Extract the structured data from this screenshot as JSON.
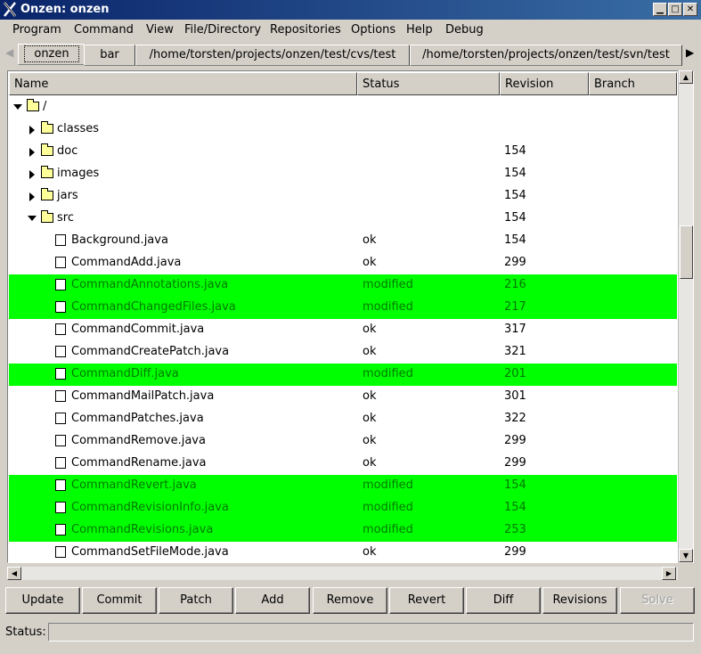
{
  "window": {
    "title": "Onzen: onzen"
  },
  "menu": [
    "Program",
    "Command",
    "View",
    "File/Directory",
    "Repositories",
    "Options",
    "Help",
    "Debug"
  ],
  "tabs": [
    "onzen",
    "bar",
    "/home/torsten/projects/onzen/test/cvs/test",
    "/home/torsten/projects/onzen/test/svn/test"
  ],
  "columns": [
    "Name",
    "Status",
    "Revision",
    "Branch"
  ],
  "tree": [
    {
      "name": "/",
      "type": "folder",
      "expand": "down",
      "level": 0,
      "status": "",
      "revision": "",
      "modified": false
    },
    {
      "name": "classes",
      "type": "folder",
      "expand": "right",
      "level": 1,
      "status": "",
      "revision": "",
      "modified": false
    },
    {
      "name": "doc",
      "type": "folder",
      "expand": "right",
      "level": 1,
      "status": "",
      "revision": "154",
      "modified": false
    },
    {
      "name": "images",
      "type": "folder",
      "expand": "right",
      "level": 1,
      "status": "",
      "revision": "154",
      "modified": false
    },
    {
      "name": "jars",
      "type": "folder",
      "expand": "right",
      "level": 1,
      "status": "",
      "revision": "154",
      "modified": false
    },
    {
      "name": "src",
      "type": "folder",
      "expand": "down",
      "level": 1,
      "status": "",
      "revision": "154",
      "modified": false
    },
    {
      "name": "Background.java",
      "type": "file",
      "level": 2,
      "status": "ok",
      "revision": "154",
      "modified": false
    },
    {
      "name": "CommandAdd.java",
      "type": "file",
      "level": 2,
      "status": "ok",
      "revision": "299",
      "modified": false
    },
    {
      "name": "CommandAnnotations.java",
      "type": "file",
      "level": 2,
      "status": "modified",
      "revision": "216",
      "modified": true
    },
    {
      "name": "CommandChangedFiles.java",
      "type": "file",
      "level": 2,
      "status": "modified",
      "revision": "217",
      "modified": true
    },
    {
      "name": "CommandCommit.java",
      "type": "file",
      "level": 2,
      "status": "ok",
      "revision": "317",
      "modified": false
    },
    {
      "name": "CommandCreatePatch.java",
      "type": "file",
      "level": 2,
      "status": "ok",
      "revision": "321",
      "modified": false
    },
    {
      "name": "CommandDiff.java",
      "type": "file",
      "level": 2,
      "status": "modified",
      "revision": "201",
      "modified": true
    },
    {
      "name": "CommandMailPatch.java",
      "type": "file",
      "level": 2,
      "status": "ok",
      "revision": "301",
      "modified": false
    },
    {
      "name": "CommandPatches.java",
      "type": "file",
      "level": 2,
      "status": "ok",
      "revision": "322",
      "modified": false
    },
    {
      "name": "CommandRemove.java",
      "type": "file",
      "level": 2,
      "status": "ok",
      "revision": "299",
      "modified": false
    },
    {
      "name": "CommandRename.java",
      "type": "file",
      "level": 2,
      "status": "ok",
      "revision": "299",
      "modified": false
    },
    {
      "name": "CommandRevert.java",
      "type": "file",
      "level": 2,
      "status": "modified",
      "revision": "154",
      "modified": true
    },
    {
      "name": "CommandRevisionInfo.java",
      "type": "file",
      "level": 2,
      "status": "modified",
      "revision": "154",
      "modified": true
    },
    {
      "name": "CommandRevisions.java",
      "type": "file",
      "level": 2,
      "status": "modified",
      "revision": "253",
      "modified": true
    },
    {
      "name": "CommandSetFileMode.java",
      "type": "file",
      "level": 2,
      "status": "ok",
      "revision": "299",
      "modified": false
    }
  ],
  "buttons": [
    {
      "label": "Update",
      "disabled": false
    },
    {
      "label": "Commit",
      "disabled": false
    },
    {
      "label": "Patch",
      "disabled": false
    },
    {
      "label": "Add",
      "disabled": false
    },
    {
      "label": "Remove",
      "disabled": false
    },
    {
      "label": "Revert",
      "disabled": false
    },
    {
      "label": "Diff",
      "disabled": false
    },
    {
      "label": "Revisions",
      "disabled": false
    },
    {
      "label": "Solve",
      "disabled": true
    }
  ],
  "status": {
    "label": "Status:",
    "value": ""
  },
  "colors": {
    "modified_row": "#00ff00",
    "modified_text": "#007a00",
    "folder": "#ffff9a"
  },
  "icons": {
    "window": "x-icon",
    "folder": "folder-icon",
    "file": "file-icon"
  }
}
